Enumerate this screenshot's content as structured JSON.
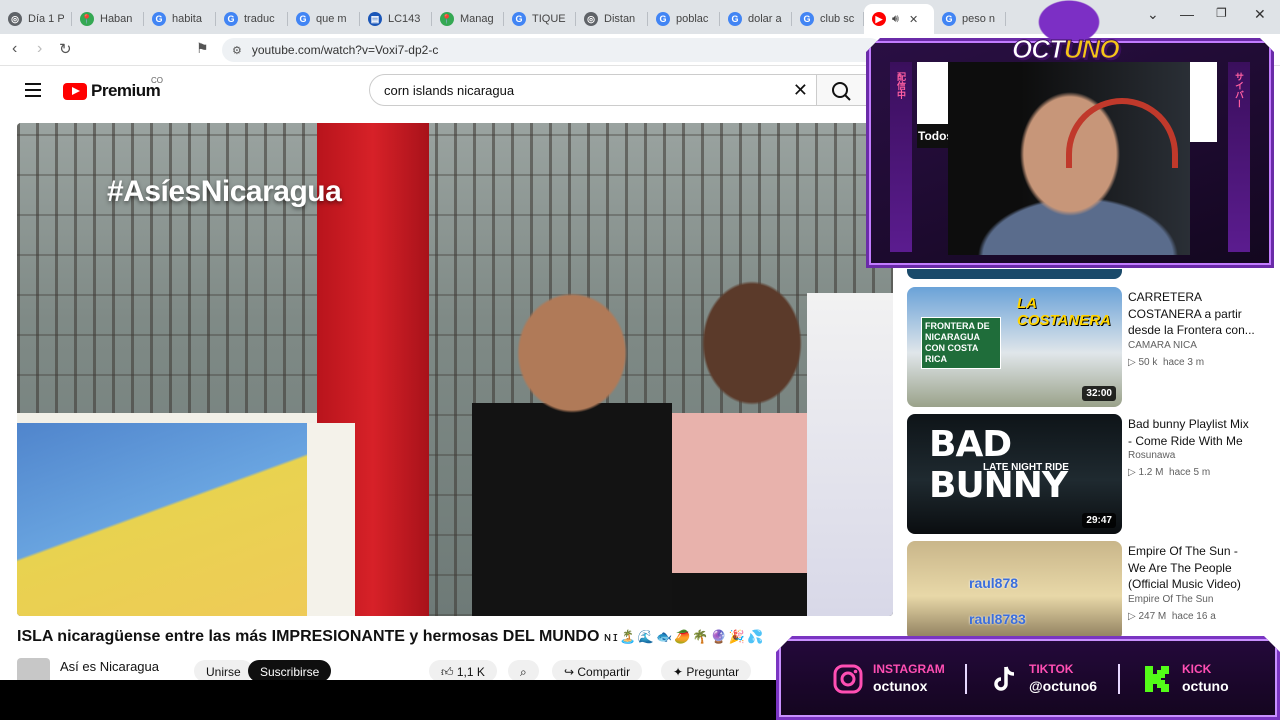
{
  "browser": {
    "tabs": [
      {
        "label": "Día 1 P",
        "color": "#5f6368",
        "glyph": "◎"
      },
      {
        "label": "Haban",
        "color": "#34a853",
        "glyph": "📍"
      },
      {
        "label": "habita",
        "color": "#4285f4",
        "glyph": "G"
      },
      {
        "label": "traduc",
        "color": "#4285f4",
        "glyph": "G"
      },
      {
        "label": "que m",
        "color": "#4285f4",
        "glyph": "G"
      },
      {
        "label": "LC143",
        "color": "#1a56b8",
        "glyph": "▤"
      },
      {
        "label": "Manag",
        "color": "#34a853",
        "glyph": "📍"
      },
      {
        "label": "TIQUE",
        "color": "#4285f4",
        "glyph": "G"
      },
      {
        "label": "Distan",
        "color": "#5f6368",
        "glyph": "◎"
      },
      {
        "label": "poblac",
        "color": "#4285f4",
        "glyph": "G"
      },
      {
        "label": "dolar a",
        "color": "#4285f4",
        "glyph": "G"
      },
      {
        "label": "club sc",
        "color": "#4285f4",
        "glyph": "G"
      },
      {
        "label": "",
        "color": "#ff0000",
        "glyph": "▶",
        "active": true
      },
      {
        "label": "peso n",
        "color": "#4285f4",
        "glyph": "G"
      }
    ],
    "url": "youtube.com/watch?v=Voxi7-dp2-c"
  },
  "youtube": {
    "logo_text": "Premium",
    "country_code": "CO",
    "search_query": "corn islands nicaragua",
    "video_overlay_text": "#AsíesNicaragua",
    "video_title": "ISLA nicaragüense entre las más IMPRESIONANTE y hermosas DEL MUNDO",
    "title_emojis": "ɴɪ🏝️🌊🐟🥭🌴🔮🎉💦",
    "channel_name": "Así es Nicaragua",
    "join_label": "Unirse",
    "subscribe_label": "Suscribirse",
    "likes": "1,1 K",
    "share_label": "Compartir",
    "ask_label": "Preguntar",
    "filter_chip": "Todos"
  },
  "sidebar": [
    {
      "title": "CARRETERA COSTANERA a partir desde la Frontera con...",
      "channel": "CAMARA NICA",
      "views": "50 k",
      "age": "hace 3 m",
      "duration": "32:00",
      "thumb_text_top": "LA COSTANERA",
      "thumb_text_sign": "FRONTERA DE NICARAGUA CON COSTA RICA",
      "thumb_colors": [
        "#6aa2d8",
        "#e0e6ea",
        "#9aa28a"
      ]
    },
    {
      "title": "Bad bunny Playlist Mix - Come Ride With Me",
      "channel": "Rosunawa",
      "views": "1.2 M",
      "age": "hace 5 m",
      "duration": "29:47",
      "thumb_text_top": "BAD BUNNY",
      "thumb_text_sign": "LATE NIGHT RIDE",
      "thumb_colors": [
        "#0e1418",
        "#1f2a30",
        "#0a0d10"
      ]
    },
    {
      "title": "Empire Of The Sun - We Are The People (Official Music Video)",
      "channel": "Empire Of The Sun",
      "views": "247 M",
      "age": "hace 16 a",
      "duration": "",
      "thumb_text_top": "raul878",
      "thumb_text_sign": "raul8783",
      "thumb_colors": [
        "#c9b68a",
        "#e8d8a8",
        "#8a7a5a"
      ]
    }
  ],
  "overlay": {
    "brand": "OCTUNO",
    "brand_a": "OCT",
    "brand_b": "UNO",
    "strip_left": "配信中",
    "strip_right": "サイバー",
    "socials": [
      {
        "platform": "INSTAGRAM",
        "handle": "octunox",
        "color": "#ff4fb3"
      },
      {
        "platform": "TIKTOK",
        "handle": "@octuno6",
        "color": "#ffffff"
      },
      {
        "platform": "KICK",
        "handle": "octuno",
        "color": "#53fc18"
      }
    ]
  }
}
